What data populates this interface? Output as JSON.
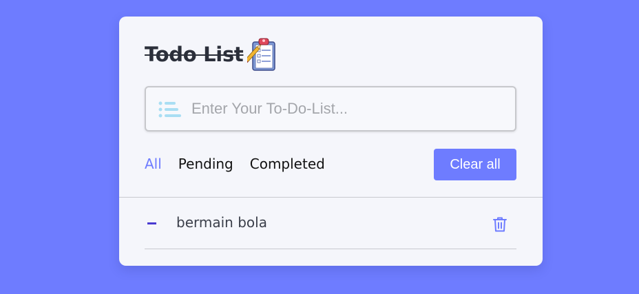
{
  "app": {
    "title": "Todo List",
    "title_emoji_icon": "clipboard-checklist-icon"
  },
  "input": {
    "placeholder": "Enter Your To-Do-List...",
    "value": "",
    "icon": "list-icon"
  },
  "filters": [
    {
      "label": "All",
      "active": true
    },
    {
      "label": "Pending",
      "active": false
    },
    {
      "label": "Completed",
      "active": false
    }
  ],
  "actions": {
    "clear_all_label": "Clear all"
  },
  "tasks": [
    {
      "name": "bermain bola",
      "status_icon": "dash-icon",
      "delete_icon": "trash-icon"
    }
  ],
  "colors": {
    "background": "#6e7cff",
    "card": "#f5f6fb",
    "accent": "#6e7cff",
    "task_marker": "#4a3bd1"
  }
}
